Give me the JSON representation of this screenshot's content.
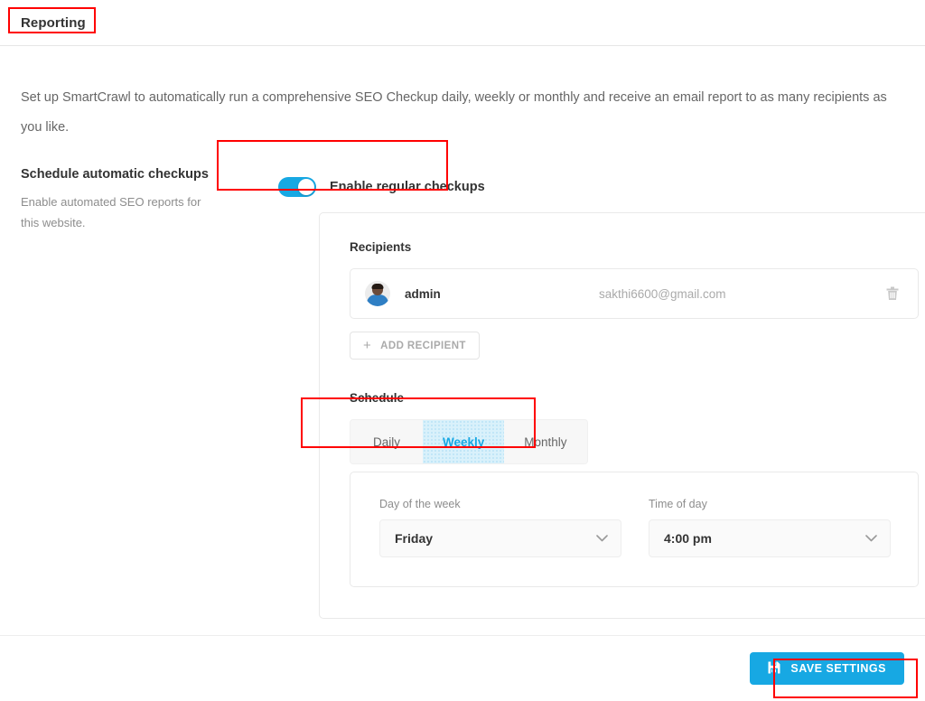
{
  "header": {
    "title": "Reporting"
  },
  "intro": {
    "text": "Set up SmartCrawl to automatically run a comprehensive SEO Checkup daily, weekly or monthly and receive an email report to as many recipients as you like."
  },
  "schedule_setting": {
    "label": "Schedule automatic checkups",
    "description": "Enable automated SEO reports for this website.",
    "toggle": {
      "label": "Enable regular checkups",
      "enabled": true,
      "on_color": "#17a8e3"
    }
  },
  "card": {
    "recipients": {
      "title": "Recipients",
      "rows": [
        {
          "avatar": "user-photo-avatar",
          "name": "admin",
          "email": "sakthi6600@gmail.com",
          "delete_icon": "trash-icon"
        }
      ],
      "add_button": {
        "label": "ADD RECIPIENT",
        "icon": "plus-icon"
      }
    },
    "schedule": {
      "title": "Schedule",
      "tabs": [
        {
          "label": "Daily",
          "active": false
        },
        {
          "label": "Weekly",
          "active": true
        },
        {
          "label": "Monthly",
          "active": false
        }
      ],
      "active_tab": "Weekly",
      "fields": [
        {
          "label": "Day of the week",
          "value": "Friday",
          "icon": "chevron-down-icon"
        },
        {
          "label": "Time of day",
          "value": "4:00 pm",
          "icon": "chevron-down-icon"
        }
      ]
    }
  },
  "footer": {
    "save_button": {
      "label": "SAVE SETTINGS",
      "icon": "floppy-save-icon",
      "color": "#17a8e3"
    }
  },
  "annotations": {
    "highlight_color": "#ff0000",
    "boxes": [
      "page-title",
      "enable-toggle",
      "schedule-tabs",
      "save-settings-button"
    ]
  }
}
